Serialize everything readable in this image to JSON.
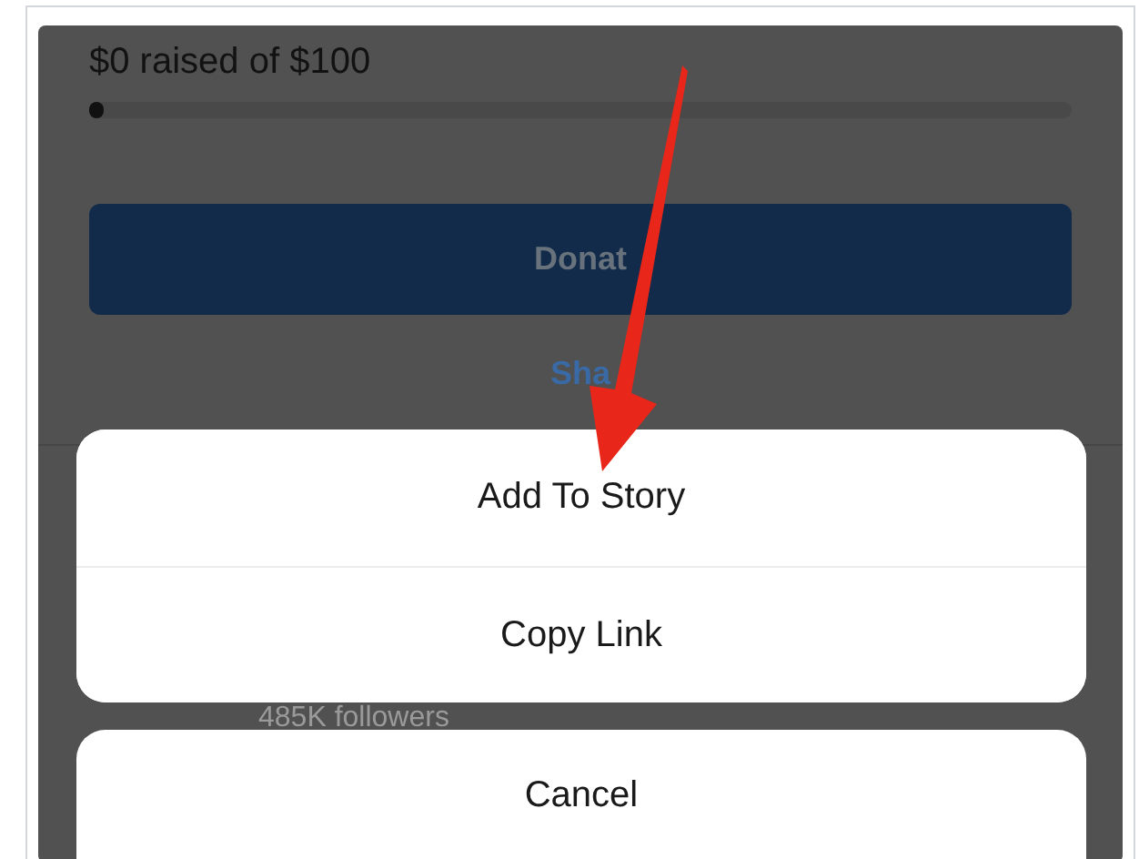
{
  "fundraiser": {
    "progress_text": "$0 raised of $100",
    "level": 0
  },
  "donate_button": "Donat",
  "share_link": "Sha",
  "profile": {
    "followers": "485K followers"
  },
  "action_sheet": {
    "actions": [
      "Add To Story",
      "Copy Link"
    ],
    "cancel": "Cancel"
  }
}
